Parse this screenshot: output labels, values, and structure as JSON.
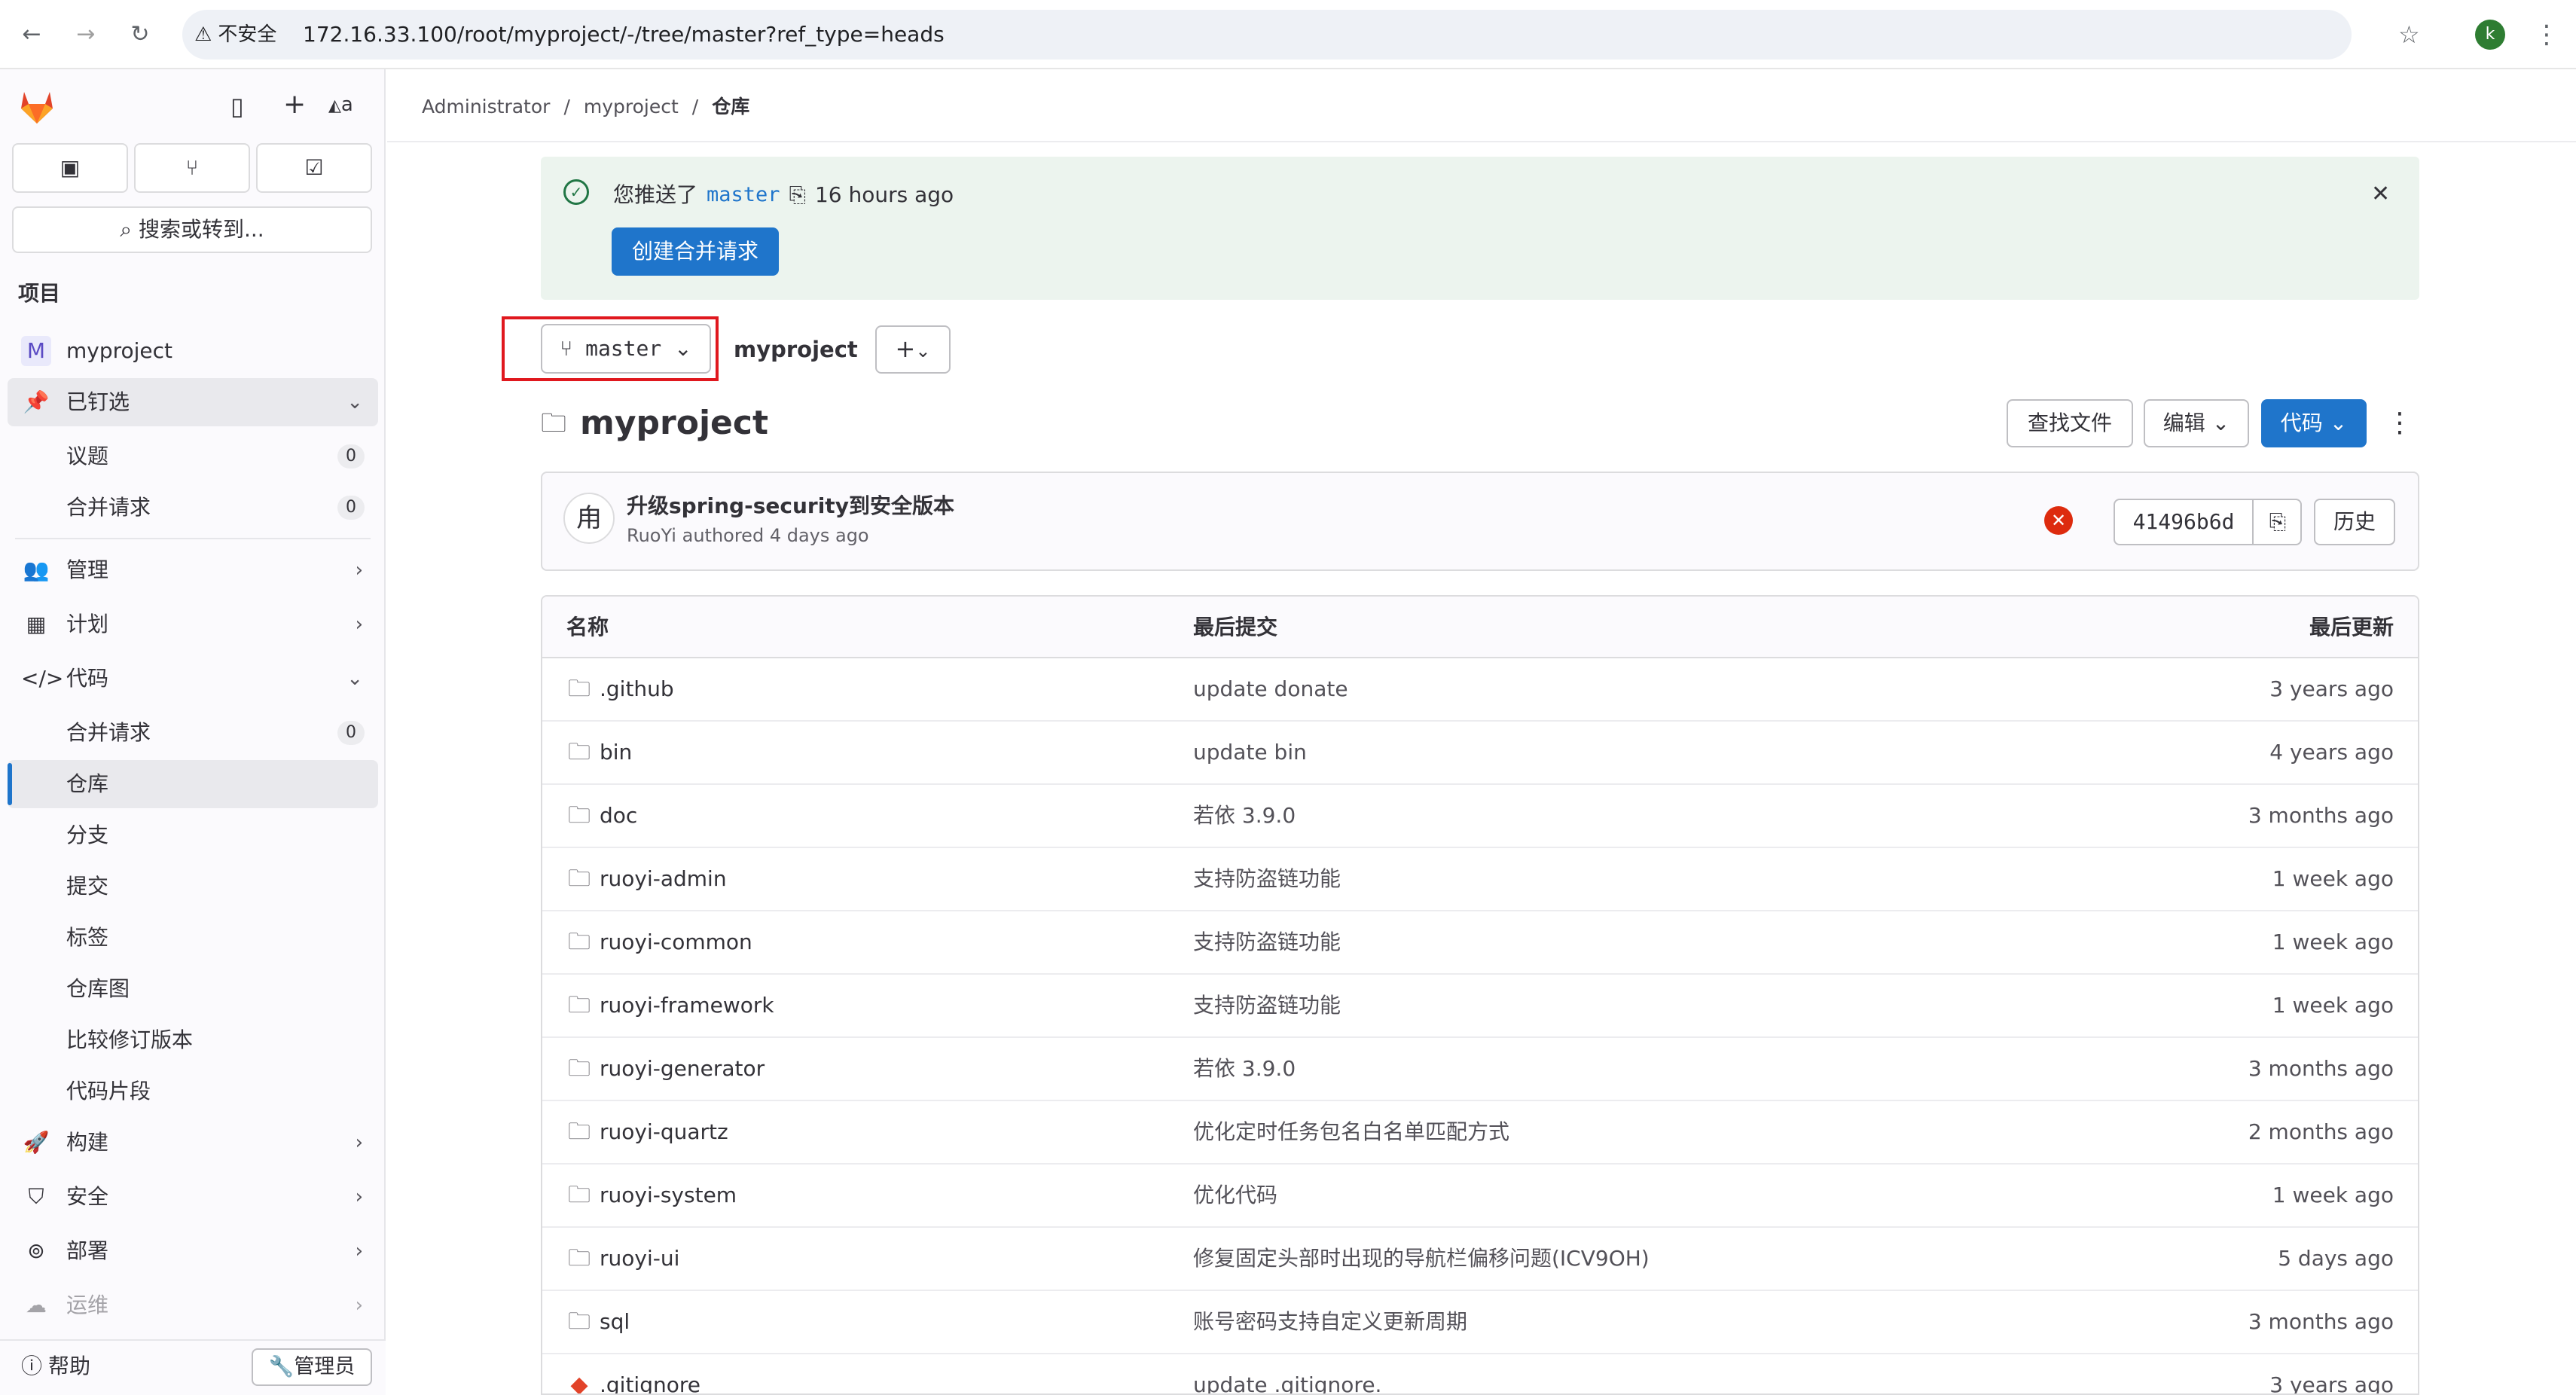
{
  "browser": {
    "insecure_label": "不安全",
    "url": "172.16.33.100/root/myproject/-/tree/master?ref_type=heads",
    "profile_initial": "k"
  },
  "sidebar": {
    "section_title": "项目",
    "search_label": "搜索或转到...",
    "project_avatar": "M",
    "project_name": "myproject",
    "avatar_alt": "a",
    "pinned": {
      "label": "已钉选",
      "items": [
        {
          "label": "议题",
          "count": "0"
        },
        {
          "label": "合并请求",
          "count": "0"
        }
      ]
    },
    "manage": "管理",
    "plan": "计划",
    "code": {
      "label": "代码",
      "items": [
        {
          "label": "合并请求",
          "count": "0"
        },
        {
          "label": "仓库"
        },
        {
          "label": "分支"
        },
        {
          "label": "提交"
        },
        {
          "label": "标签"
        },
        {
          "label": "仓库图"
        },
        {
          "label": "比较修订版本"
        },
        {
          "label": "代码片段"
        }
      ]
    },
    "build": "构建",
    "secure": "安全",
    "deploy": "部署",
    "operate": "运维",
    "help": "帮助",
    "admin": "管理员"
  },
  "breadcrumb": {
    "owner": "Administrator",
    "project": "myproject",
    "current": "仓库"
  },
  "alert": {
    "prefix": "您推送了",
    "branch": "master",
    "time": "16 hours ago",
    "button": "创建合并请求"
  },
  "repo": {
    "branch": "master",
    "path_project": "myproject",
    "path_sep": "/",
    "title": "myproject",
    "find_file": "查找文件",
    "edit": "编辑",
    "code": "代码"
  },
  "commit": {
    "avatar": "甪",
    "title": "升级spring-security到安全版本",
    "author": "RuoYi",
    "authored": "authored",
    "when": "4 days ago",
    "sha": "41496b6d",
    "history": "历史"
  },
  "table": {
    "headers": {
      "name": "名称",
      "last_commit": "最后提交",
      "last_update": "最后更新"
    },
    "rows": [
      {
        "name": ".github",
        "message": "update donate",
        "date": "3 years ago"
      },
      {
        "name": "bin",
        "message": "update bin",
        "date": "4 years ago"
      },
      {
        "name": "doc",
        "message": "若依 3.9.0",
        "date": "3 months ago"
      },
      {
        "name": "ruoyi-admin",
        "message": "支持防盗链功能",
        "date": "1 week ago"
      },
      {
        "name": "ruoyi-common",
        "message": "支持防盗链功能",
        "date": "1 week ago"
      },
      {
        "name": "ruoyi-framework",
        "message": "支持防盗链功能",
        "date": "1 week ago"
      },
      {
        "name": "ruoyi-generator",
        "message": "若依 3.9.0",
        "date": "3 months ago"
      },
      {
        "name": "ruoyi-quartz",
        "message": "优化定时任务包名白名单匹配方式",
        "date": "2 months ago"
      },
      {
        "name": "ruoyi-system",
        "message": "优化代码",
        "date": "1 week ago"
      },
      {
        "name": "ruoyi-ui",
        "message": "修复固定头部时出现的导航栏偏移问题(ICV9OH)",
        "date": "5 days ago"
      },
      {
        "name": "sql",
        "message": "账号密码支持自定义更新周期",
        "date": "3 months ago"
      },
      {
        "name": ".gitignore",
        "message": "update .gitignore.",
        "date": "3 years ago"
      }
    ]
  },
  "colors": {
    "primary": "#1f75cb",
    "alert_bg": "#ecf4ee",
    "highlight": "#e0181e",
    "fail": "#dd2b0e"
  }
}
